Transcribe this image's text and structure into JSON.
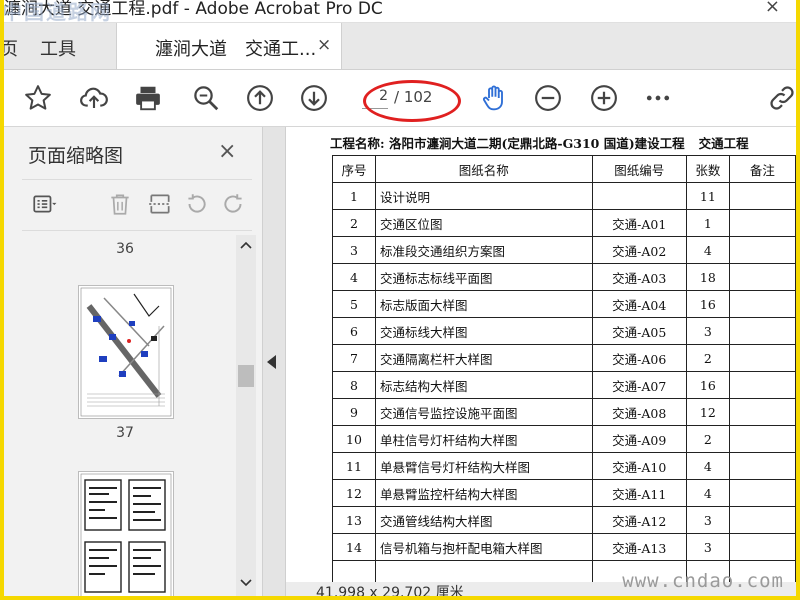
{
  "window": {
    "title": "瀍涧大道 交通工程.pdf - Adobe Acrobat Pro DC",
    "watermark_logo": "中国道路网",
    "close_glyph": "×"
  },
  "tabs": {
    "home_partial": "页",
    "tools": "工具",
    "document": "瀍涧大道　交通工...",
    "document_close": "×"
  },
  "toolbar": {
    "icons": [
      "star-icon",
      "cloud-upload-icon",
      "print-icon",
      "zoom-icon",
      "page-up-icon",
      "page-down-icon",
      "hand-icon",
      "zoom-out-icon",
      "zoom-in-icon",
      "more-icon",
      "share-link-icon"
    ],
    "current_page": "2",
    "total_pages": "/ 102",
    "hand_color": "#2f6fd6"
  },
  "annotation": {
    "color": "#e02020"
  },
  "sidebar": {
    "title": "页面缩略图",
    "close": "×",
    "thumbnails": [
      {
        "page": "36"
      },
      {
        "page": "37"
      }
    ]
  },
  "document": {
    "heading": "工程名称: 洛阳市瀍涧大道二期(定鼎北路-G310 国道)建设工程",
    "heading_group": "交通工程",
    "columns": [
      "序号",
      "图纸名称",
      "图纸编号",
      "张数",
      "备注"
    ],
    "rows": [
      {
        "no": "1",
        "name": "设计说明",
        "code": "",
        "sheets": "11",
        "note": ""
      },
      {
        "no": "2",
        "name": "交通区位图",
        "code": "交通-A01",
        "sheets": "1",
        "note": ""
      },
      {
        "no": "3",
        "name": "标准段交通组织方案图",
        "code": "交通-A02",
        "sheets": "4",
        "note": ""
      },
      {
        "no": "4",
        "name": "交通标志标线平面图",
        "code": "交通-A03",
        "sheets": "18",
        "note": ""
      },
      {
        "no": "5",
        "name": "标志版面大样图",
        "code": "交通-A04",
        "sheets": "16",
        "note": ""
      },
      {
        "no": "6",
        "name": "交通标线大样图",
        "code": "交通-A05",
        "sheets": "3",
        "note": ""
      },
      {
        "no": "7",
        "name": "交通隔离栏杆大样图",
        "code": "交通-A06",
        "sheets": "2",
        "note": ""
      },
      {
        "no": "8",
        "name": "标志结构大样图",
        "code": "交通-A07",
        "sheets": "16",
        "note": ""
      },
      {
        "no": "9",
        "name": "交通信号监控设施平面图",
        "code": "交通-A08",
        "sheets": "12",
        "note": ""
      },
      {
        "no": "10",
        "name": "单柱信号灯杆结构大样图",
        "code": "交通-A09",
        "sheets": "2",
        "note": ""
      },
      {
        "no": "11",
        "name": "单悬臂信号灯杆结构大样图",
        "code": "交通-A10",
        "sheets": "4",
        "note": ""
      },
      {
        "no": "12",
        "name": "单悬臂监控杆结构大样图",
        "code": "交通-A11",
        "sheets": "4",
        "note": ""
      },
      {
        "no": "13",
        "name": "交通管线结构大样图",
        "code": "交通-A12",
        "sheets": "3",
        "note": ""
      },
      {
        "no": "14",
        "name": "信号机箱与抱杆配电箱大样图",
        "code": "交通-A13",
        "sheets": "3",
        "note": ""
      },
      {
        "no": "",
        "name": "",
        "code": "",
        "sheets": "",
        "note": ""
      }
    ]
  },
  "status": {
    "page_size": "41.998 x 29.702 厘米"
  },
  "site_watermark": "www.cndao.com"
}
